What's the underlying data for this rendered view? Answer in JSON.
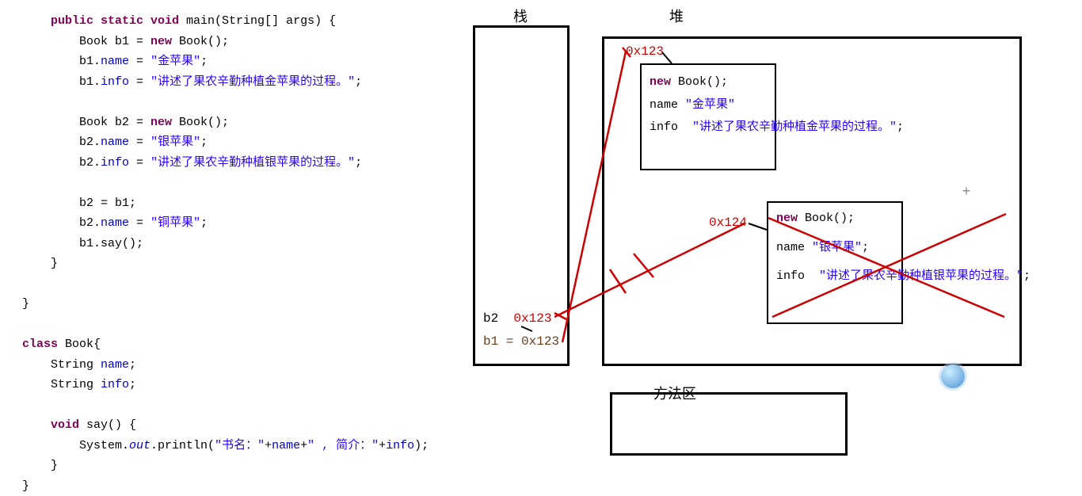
{
  "code": {
    "main_sig_1": "public static void ",
    "main_sig_2": "main(String[] args) {",
    "l1a": "Book b1 = ",
    "l1b": "new",
    "l1c": " Book();",
    "l2a": "b1.",
    "l2b": "name",
    "l2c": " = ",
    "l2d": "\"金苹果\"",
    "l2e": ";",
    "l3a": "b1.",
    "l3b": "info",
    "l3c": " = ",
    "l3d": "\"讲述了果农辛勤种植金苹果的过程。\"",
    "l3e": ";",
    "l4a": "Book b2 = ",
    "l4b": "new",
    "l4c": " Book();",
    "l5a": "b2.",
    "l5b": "name",
    "l5c": " = ",
    "l5d": "\"银苹果\"",
    "l5e": ";",
    "l6a": "b2.",
    "l6b": "info",
    "l6c": " = ",
    "l6d": "\"讲述了果农辛勤种植银苹果的过程。\"",
    "l6e": ";",
    "l7": "b2 = b1;",
    "l8a": "b2.",
    "l8b": "name",
    "l8c": " = ",
    "l8d": "\"铜苹果\"",
    "l8e": ";",
    "l9": "b1.say();",
    "close1": "}",
    "close2": "}",
    "class_kw": "class ",
    "class_name": "Book{",
    "field1a": "String ",
    "field1b": "name",
    "field1c": ";",
    "field2a": "String ",
    "field2b": "info",
    "field2c": ";",
    "say_sig_a": "void ",
    "say_sig_b": "say() {",
    "say_body_a": "System.",
    "say_body_b": "out",
    "say_body_c": ".println(",
    "say_body_d": "\"书名：\"",
    "say_body_e": "+",
    "say_body_f": "name",
    "say_body_g": "+",
    "say_body_h": "\" , 简介：\"",
    "say_body_i": "+",
    "say_body_j": "info",
    "say_body_k": ");",
    "say_close": "}",
    "class_close": "}"
  },
  "labels": {
    "stack": "栈",
    "heap": "堆",
    "method_area": "方法区"
  },
  "stack": {
    "b2": "b2",
    "b2_addr": "0x123",
    "b1_line": "b1 = 0x123"
  },
  "addresses": {
    "obj1": "0x123",
    "obj2": "0x124"
  },
  "heap": {
    "obj1": {
      "new_kw": "new",
      "new_rest": " Book();",
      "name_key": "name",
      "name_val": "\"金苹果\"",
      "info_key": "info",
      "info_val": "\"讲述了果农辛勤种植金苹果的过程。\"",
      "semi": ";"
    },
    "obj2": {
      "new_kw": "new",
      "new_rest": " Book();",
      "name_key": "name",
      "name_val": "\"银苹果\"",
      "name_semi": ";",
      "info_key": "info",
      "info_val": "\"讲述了果农辛勤种植银苹果的过程。\"",
      "semi": ";"
    }
  }
}
